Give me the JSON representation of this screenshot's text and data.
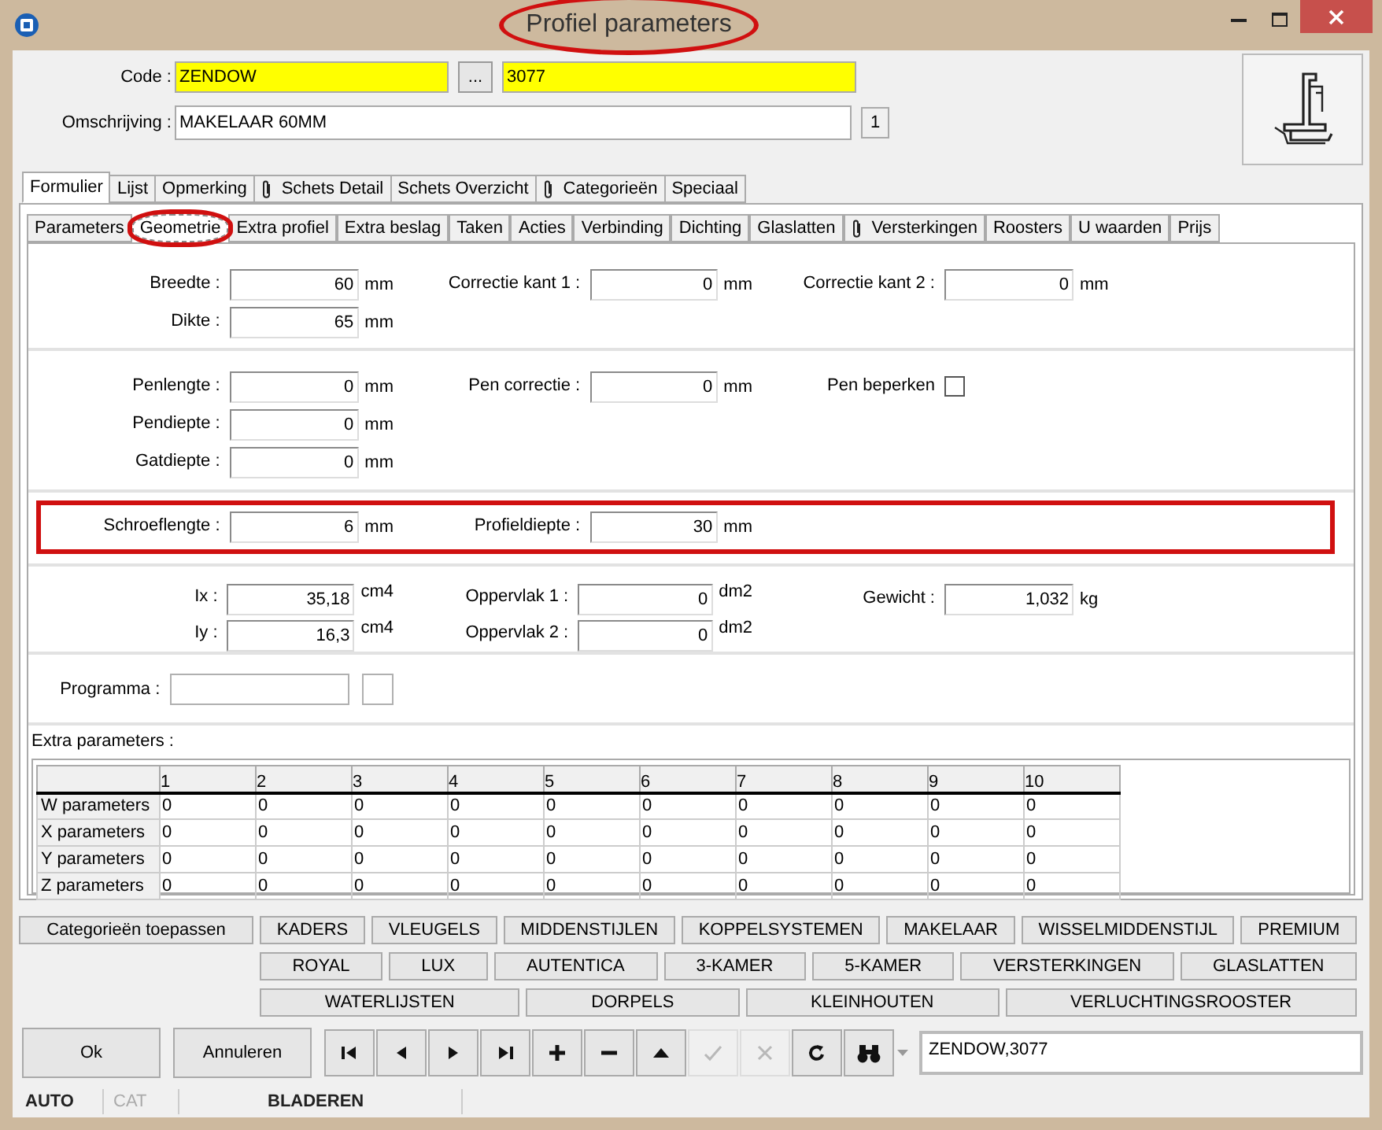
{
  "window": {
    "title": "Profiel parameters",
    "title_highlighted": true
  },
  "header": {
    "code_label": "Code :",
    "code": "ZENDOW",
    "browse": "...",
    "code2": "3077",
    "description_label": "Omschrijving :",
    "description": "MAKELAAR 60MM",
    "count": "1"
  },
  "main_tabs": [
    {
      "label": "Formulier",
      "selected": true,
      "attachment": false
    },
    {
      "label": "Lijst",
      "selected": false,
      "attachment": false
    },
    {
      "label": "Opmerking",
      "selected": false,
      "attachment": false
    },
    {
      "label": "Schets Detail",
      "selected": false,
      "attachment": true
    },
    {
      "label": "Schets Overzicht",
      "selected": false,
      "attachment": false
    },
    {
      "label": "Categorieën",
      "selected": false,
      "attachment": true
    },
    {
      "label": "Speciaal",
      "selected": false,
      "attachment": false
    }
  ],
  "sub_tabs": [
    {
      "label": "Parameters",
      "selected": false,
      "attachment": false,
      "highlighted": false
    },
    {
      "label": "Geometrie",
      "selected": true,
      "attachment": false,
      "highlighted": true
    },
    {
      "label": "Extra profiel",
      "selected": false,
      "attachment": false,
      "highlighted": false
    },
    {
      "label": "Extra beslag",
      "selected": false,
      "attachment": false,
      "highlighted": false
    },
    {
      "label": "Taken",
      "selected": false,
      "attachment": false,
      "highlighted": false
    },
    {
      "label": "Acties",
      "selected": false,
      "attachment": false,
      "highlighted": false
    },
    {
      "label": "Verbinding",
      "selected": false,
      "attachment": false,
      "highlighted": false
    },
    {
      "label": "Dichting",
      "selected": false,
      "attachment": false,
      "highlighted": false
    },
    {
      "label": "Glaslatten",
      "selected": false,
      "attachment": false,
      "highlighted": false
    },
    {
      "label": "Versterkingen",
      "selected": false,
      "attachment": true,
      "highlighted": false
    },
    {
      "label": "Roosters",
      "selected": false,
      "attachment": false,
      "highlighted": false
    },
    {
      "label": "U waarden",
      "selected": false,
      "attachment": false,
      "highlighted": false
    },
    {
      "label": "Prijs",
      "selected": false,
      "attachment": false,
      "highlighted": false
    }
  ],
  "sections": [
    {
      "columns": [
        [
          {
            "kind": "number",
            "label": "Breedte :",
            "value": "60",
            "unit": "mm"
          },
          {
            "kind": "number",
            "label": "Dikte :",
            "value": "65",
            "unit": "mm"
          }
        ],
        [
          {
            "kind": "number",
            "label": "Correctie kant 1 :",
            "value": "0",
            "unit": "mm"
          }
        ],
        [
          {
            "kind": "number",
            "label": "Correctie kant 2 :",
            "value": "0",
            "unit": "mm"
          }
        ]
      ]
    },
    {
      "columns": [
        [
          {
            "kind": "number",
            "label": "Penlengte :",
            "value": "0",
            "unit": "mm"
          },
          {
            "kind": "number",
            "label": "Pendiepte :",
            "value": "0",
            "unit": "mm"
          },
          {
            "kind": "number",
            "label": "Gatdiepte :",
            "value": "0",
            "unit": "mm"
          }
        ],
        [
          {
            "kind": "number",
            "label": "Pen correctie :",
            "value": "0",
            "unit": "mm"
          }
        ],
        [
          {
            "kind": "checkbox",
            "label": "Pen beperken",
            "checked": false
          }
        ]
      ]
    },
    {
      "highlighted": true,
      "columns": [
        [
          {
            "kind": "number",
            "label": "Schroeflengte :",
            "value": "6",
            "unit": "mm"
          }
        ],
        [
          {
            "kind": "number",
            "label": "Profieldiepte :",
            "value": "30",
            "unit": "mm"
          }
        ],
        []
      ]
    },
    {
      "columns": [
        [
          {
            "kind": "measure",
            "label": "Ix :",
            "value": "35,18",
            "unit": "cm4"
          },
          {
            "kind": "measure",
            "label": "Iy :",
            "value": "16,3",
            "unit": "cm4"
          }
        ],
        [
          {
            "kind": "measure",
            "label": "Oppervlak 1 :",
            "value": "0",
            "unit": "dm2"
          },
          {
            "kind": "measure",
            "label": "Oppervlak 2 :",
            "value": "0",
            "unit": "dm2"
          }
        ],
        [
          {
            "kind": "number",
            "label": "Gewicht :",
            "value": "1,032",
            "unit": "kg"
          }
        ]
      ]
    },
    {
      "columns": [
        [
          {
            "kind": "program",
            "label": "Programma :"
          }
        ],
        [],
        []
      ]
    }
  ],
  "extra": {
    "label": "Extra parameters :",
    "columns": [
      "1",
      "2",
      "3",
      "4",
      "5",
      "6",
      "7",
      "8",
      "9",
      "10"
    ],
    "rows": [
      {
        "label": "W parameters",
        "values": [
          "0",
          "0",
          "0",
          "0",
          "0",
          "0",
          "0",
          "0",
          "0",
          "0"
        ]
      },
      {
        "label": "X parameters",
        "values": [
          "0",
          "0",
          "0",
          "0",
          "0",
          "0",
          "0",
          "0",
          "0",
          "0"
        ]
      },
      {
        "label": "Y parameters",
        "values": [
          "0",
          "0",
          "0",
          "0",
          "0",
          "0",
          "0",
          "0",
          "0",
          "0"
        ]
      },
      {
        "label": "Z parameters",
        "values": [
          "0",
          "0",
          "0",
          "0",
          "0",
          "0",
          "0",
          "0",
          "0",
          "0"
        ]
      }
    ]
  },
  "categories": {
    "apply": "Categorieën toepassen",
    "rows": [
      [
        "KADERS",
        "VLEUGELS",
        "MIDDENSTIJLEN",
        "KOPPELSYSTEMEN",
        "MAKELAAR",
        "WISSELMIDDENSTIJL",
        "PREMIUM"
      ],
      [
        "ROYAL",
        "LUX",
        "AUTENTICA",
        "3-KAMER",
        "5-KAMER",
        "VERSTERKINGEN",
        "GLASLATTEN"
      ],
      [
        "WATERLIJSTEN",
        "DORPELS",
        "KLEINHOUTEN",
        "VERLUCHTINGSROOSTER"
      ]
    ]
  },
  "footer": {
    "ok": "Ok",
    "cancel": "Annuleren",
    "tools": [
      {
        "kind": "first",
        "disabled": false
      },
      {
        "kind": "prev",
        "disabled": false
      },
      {
        "kind": "next",
        "disabled": false
      },
      {
        "kind": "last",
        "disabled": false
      },
      {
        "kind": "add",
        "disabled": false
      },
      {
        "kind": "remove",
        "disabled": false
      },
      {
        "kind": "up",
        "disabled": false
      },
      {
        "kind": "confirm",
        "disabled": true
      },
      {
        "kind": "cancel",
        "disabled": true
      },
      {
        "kind": "refresh",
        "disabled": false
      },
      {
        "kind": "find",
        "disabled": false
      }
    ],
    "search": "ZENDOW,3077"
  },
  "status_bar": [
    {
      "text": "AUTO",
      "disabled": false
    },
    {
      "text": "CAT",
      "disabled": true
    },
    {
      "text": "BLADEREN",
      "disabled": false
    }
  ]
}
